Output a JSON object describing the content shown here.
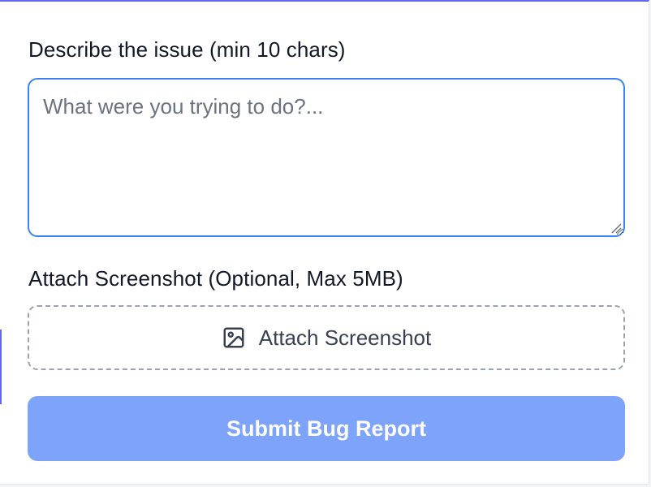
{
  "form": {
    "issue_label": "Describe the issue (min 10 chars)",
    "issue_placeholder": "What were you trying to do?...",
    "issue_value": "",
    "attach_label": "Attach Screenshot (Optional, Max 5MB)",
    "attach_button_label": "Attach Screenshot",
    "attach_icon": "image-icon",
    "submit_label": "Submit Bug Report"
  },
  "colors": {
    "accent": "#6366f1",
    "focus_border": "#3b82f6",
    "submit_bg": "#7ea3fb",
    "dashed_border": "#9ca3af"
  }
}
